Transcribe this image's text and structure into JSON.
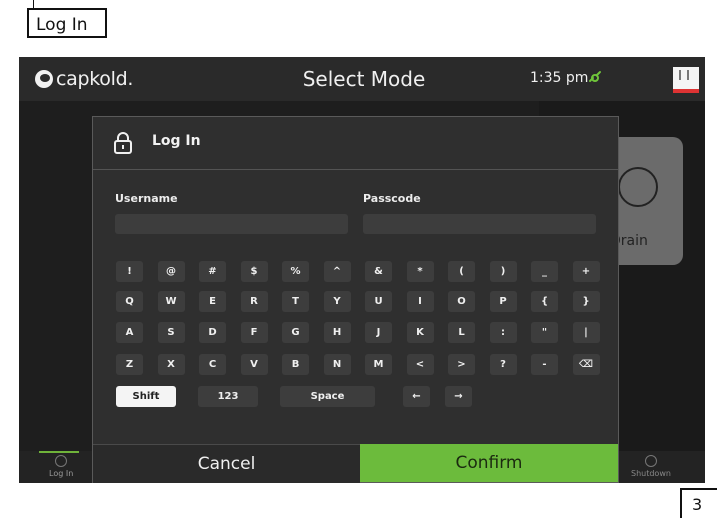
{
  "callout": {
    "label": "Log In",
    "page_number": "3"
  },
  "topbar": {
    "logo_text": "capkold.",
    "title": "Select Mode",
    "time": "1:35 pm",
    "link_icon": "link-icon",
    "flag_icon": "flag-icon"
  },
  "background": {
    "drain_card_label": "Drain"
  },
  "bottom_nav": {
    "items": [
      {
        "label": "Log In",
        "icon": "lock-icon"
      },
      {
        "label": "Shutdown",
        "icon": "power-icon"
      }
    ]
  },
  "dialog": {
    "icon": "lock-icon",
    "title": "Log In",
    "username_label": "Username",
    "passcode_label": "Passcode",
    "username_value": "",
    "passcode_value": "",
    "keyboard_rows": [
      [
        "!",
        "@",
        "#",
        "$",
        "%",
        "^",
        "&",
        "*",
        "(",
        ")",
        "_",
        "+"
      ],
      [
        "Q",
        "W",
        "E",
        "R",
        "T",
        "Y",
        "U",
        "I",
        "O",
        "P",
        "{",
        "}"
      ],
      [
        "A",
        "S",
        "D",
        "F",
        "G",
        "H",
        "J",
        "K",
        "L",
        ":",
        "\"",
        "|"
      ],
      [
        "Z",
        "X",
        "C",
        "V",
        "B",
        "N",
        "M",
        "<",
        ">",
        "?",
        "-",
        "⌫"
      ]
    ],
    "bottom_row": {
      "shift": "Shift",
      "numbers": "123",
      "space": "Space",
      "left_arrow": "←",
      "right_arrow": "→"
    },
    "cancel_label": "Cancel",
    "confirm_label": "Confirm"
  },
  "colors": {
    "accent_green": "#6cbb3c",
    "background": "#1a1a1a",
    "dialog": "#2f2f2f",
    "key": "#3d3d3d"
  }
}
